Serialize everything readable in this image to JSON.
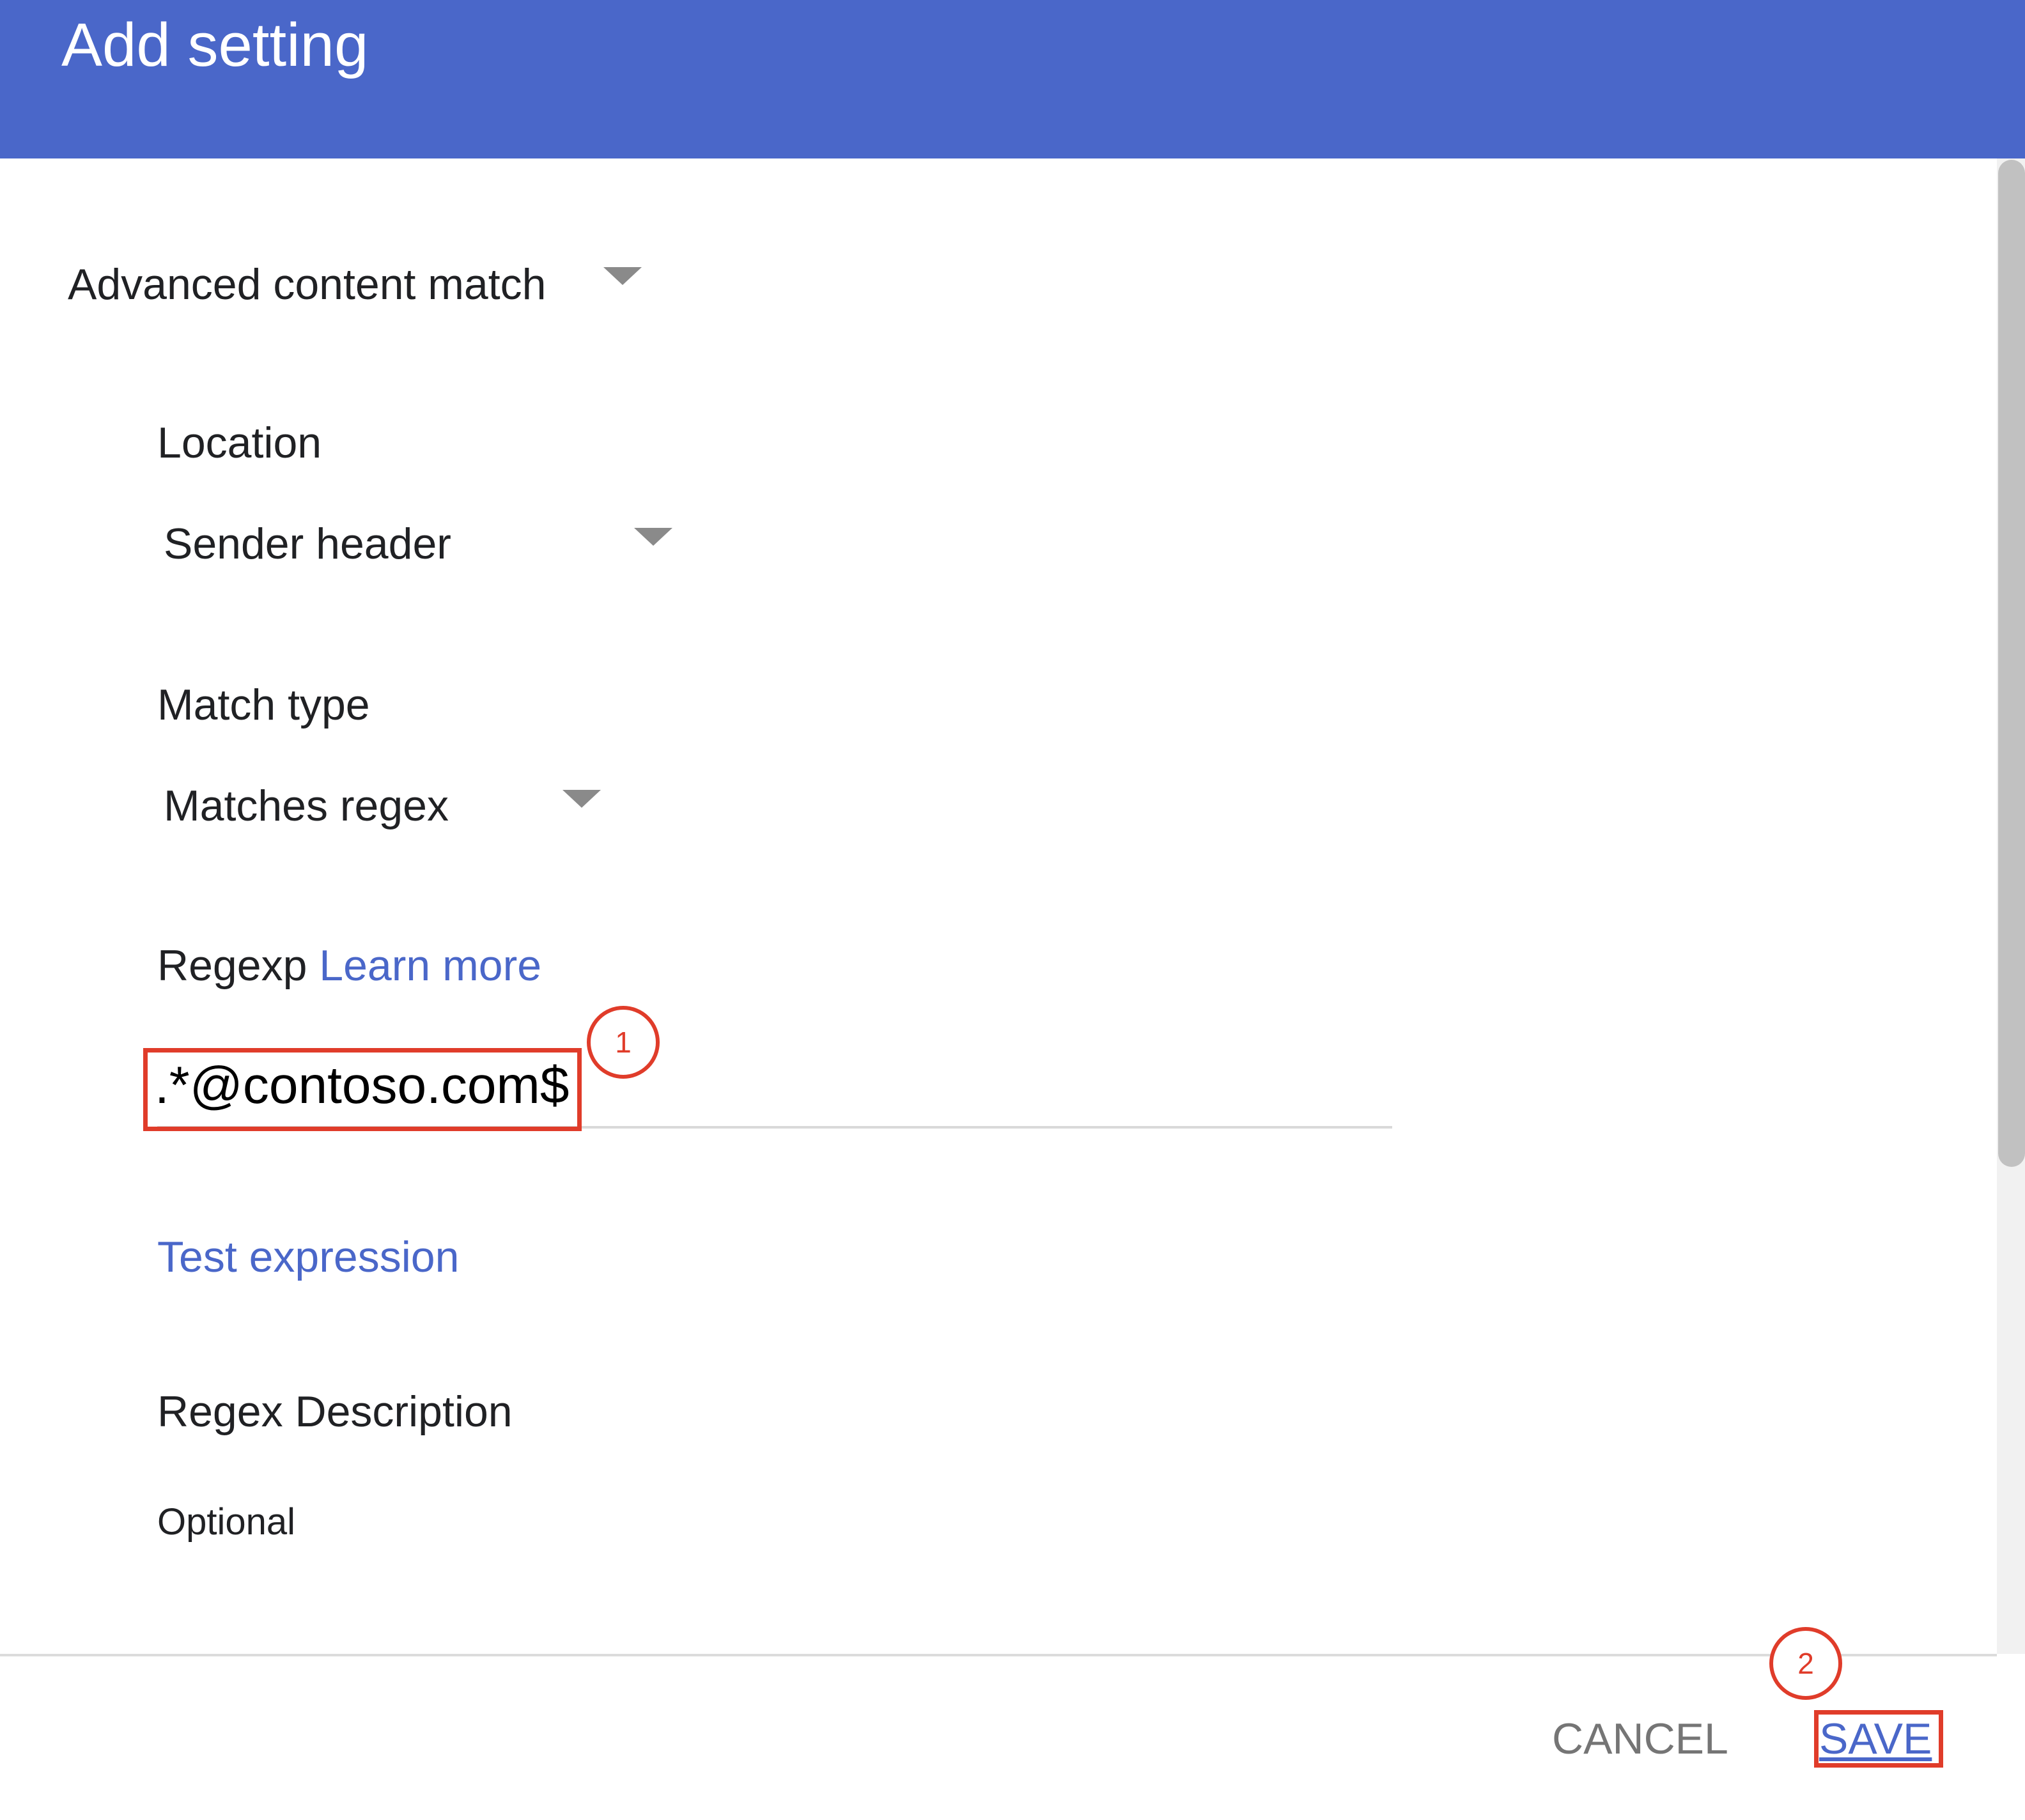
{
  "dialog": {
    "title": "Add setting"
  },
  "setting_type": {
    "selected": "Advanced content match"
  },
  "location": {
    "label": "Location",
    "selected": "Sender header"
  },
  "match_type": {
    "label": "Match type",
    "selected": "Matches regex"
  },
  "regexp": {
    "label": "Regexp",
    "learn_more": "Learn more",
    "value": ".*@contoso.com$"
  },
  "test_expression": "Test expression",
  "regex_description": {
    "label": "Regex Description",
    "placeholder": "Optional"
  },
  "annotations": {
    "step1": "1",
    "step2": "2",
    "highlight_color": "#e03c2a"
  },
  "footer": {
    "cancel_label": "CANCEL",
    "save_label": "SAVE"
  },
  "colors": {
    "header_bg": "#4a67c9",
    "link": "#4a67c9"
  }
}
